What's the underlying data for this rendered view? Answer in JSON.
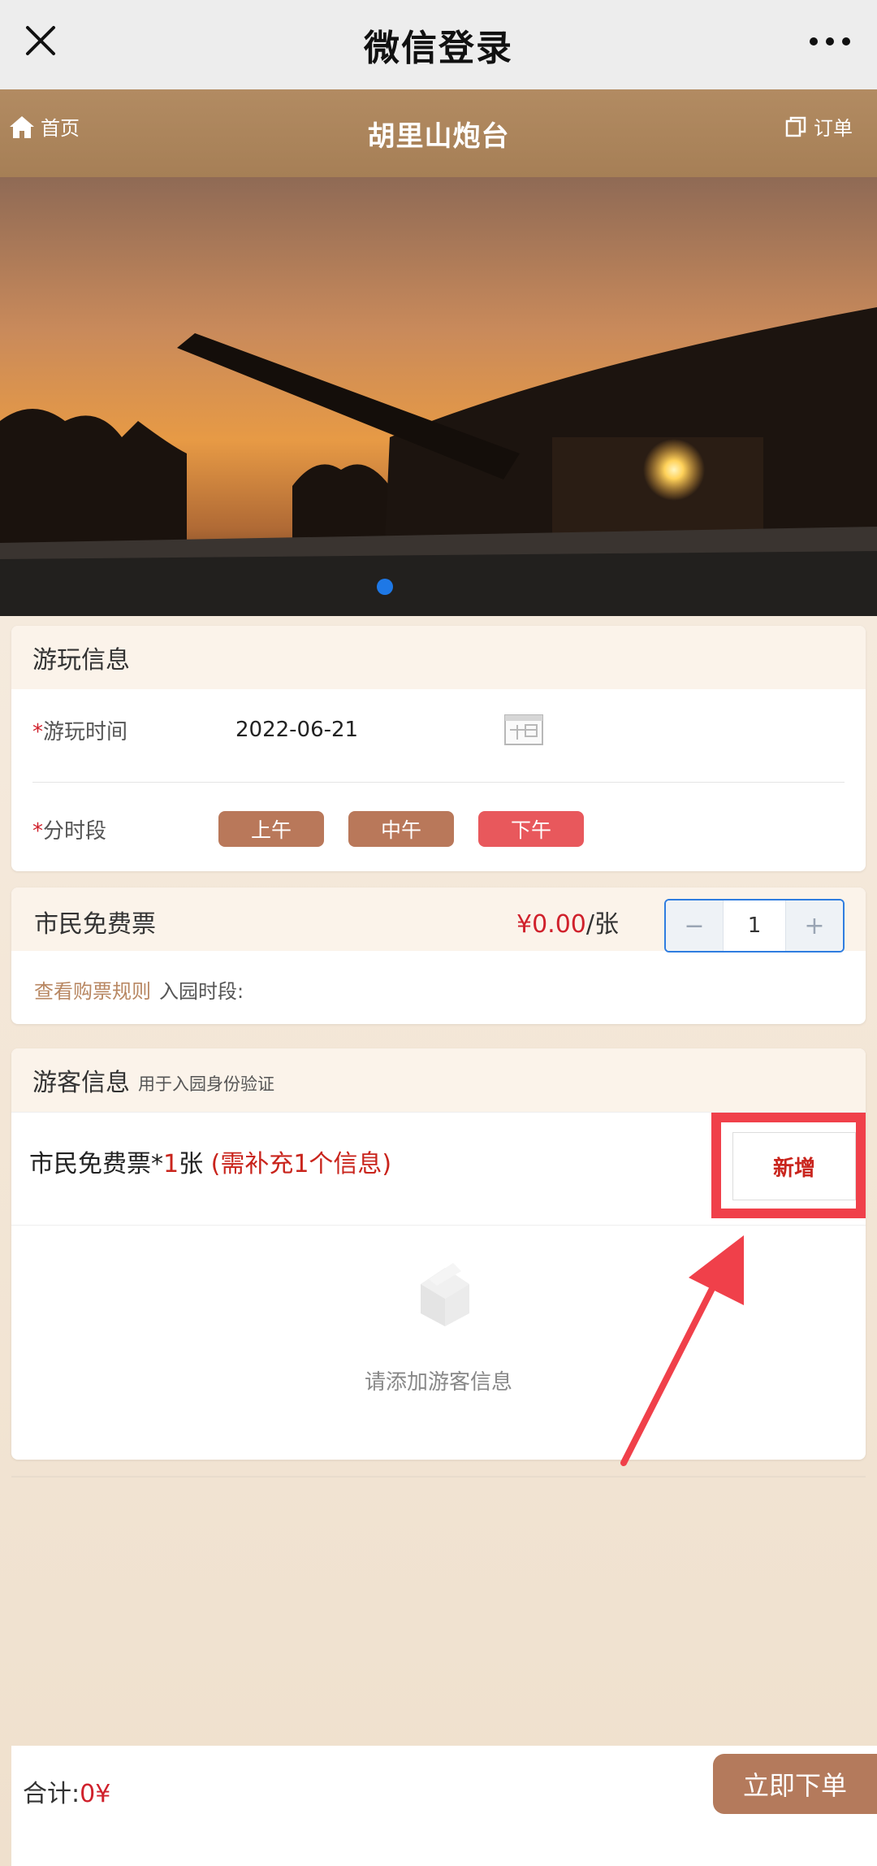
{
  "wechat_bar": {
    "title": "微信登录"
  },
  "header": {
    "title": "胡里山炮台",
    "home_label": "首页",
    "orders_label": "订单"
  },
  "banner": {
    "slide_count": 1,
    "active_slide": 0,
    "active_dot_color": "#1e78e6"
  },
  "play_info": {
    "title": "游玩信息",
    "date_label": "游玩时间",
    "date_value": "2022-06-21",
    "slot_label": "分时段",
    "required_mark": "*",
    "slots": [
      {
        "label": "上午",
        "selected": false
      },
      {
        "label": "中午",
        "selected": false
      },
      {
        "label": "下午",
        "selected": true
      }
    ]
  },
  "ticket": {
    "name": "市民免费票",
    "price": "¥0.00",
    "unit": "/张",
    "quantity": "1",
    "minus": "−",
    "plus": "+",
    "rules_link": "查看购票规则",
    "entry_period_label": "入园时段:"
  },
  "visitor": {
    "title": "游客信息",
    "subtitle": "用于入园身份验证",
    "ticket_line": "市民免费票*",
    "ticket_count": "1",
    "ticket_unit": "张",
    "need_info": "(需补充1个信息)",
    "add_button": "新增",
    "empty_text": "请添加游客信息"
  },
  "footer": {
    "total_label": "合计:",
    "total_value": "0¥",
    "order_button": "立即下单"
  },
  "colors": {
    "header_bg": "#a67f56",
    "accent_red": "#d0212c",
    "slot_normal": "#b9785a",
    "slot_active": "#e8585c",
    "order_button": "#b47a5c",
    "highlight": "#f0404a"
  }
}
